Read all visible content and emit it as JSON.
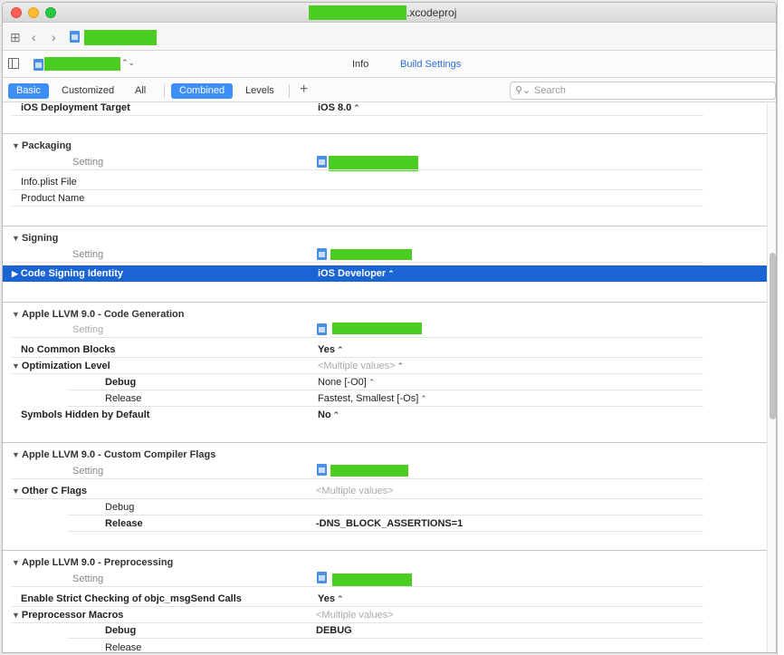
{
  "window": {
    "title_suffix": ".xcodeproj"
  },
  "editor_tabs": {
    "info": "Info",
    "build_settings": "Build Settings"
  },
  "filter": {
    "basic": "Basic",
    "customized": "Customized",
    "all": "All",
    "combined": "Combined",
    "levels": "Levels",
    "add": "+",
    "search_placeholder": "Search"
  },
  "partial_row": {
    "label": "iOS Deployment Target",
    "value": "iOS 8.0"
  },
  "sections": [
    {
      "name": "Packaging",
      "setting_header": "Setting",
      "rows": [
        {
          "label": "Info.plist File",
          "value": ""
        },
        {
          "label": "Product Name",
          "value": ""
        }
      ]
    },
    {
      "name": "Signing",
      "setting_header": "Setting",
      "rows": [
        {
          "label": "Code Signing Identity",
          "value": "iOS Developer"
        }
      ]
    },
    {
      "name": "Apple LLVM 9.0 - Code Generation",
      "setting_header": "Setting",
      "rows": [
        {
          "label": "No Common Blocks",
          "value": "Yes"
        },
        {
          "label": "Optimization Level",
          "value": "<Multiple values>"
        },
        {
          "label": "Debug",
          "value": "None [-O0]"
        },
        {
          "label": "Release",
          "value": "Fastest, Smallest [-Os]"
        },
        {
          "label": "Symbols Hidden by Default",
          "value": "No"
        }
      ]
    },
    {
      "name": "Apple LLVM 9.0 - Custom Compiler Flags",
      "setting_header": "Setting",
      "rows": [
        {
          "label": "Other C Flags",
          "value": "<Multiple values>"
        },
        {
          "label": "Debug",
          "value": ""
        },
        {
          "label": "Release",
          "value": "-DNS_BLOCK_ASSERTIONS=1"
        }
      ]
    },
    {
      "name": "Apple LLVM 9.0 - Preprocessing",
      "setting_header": "Setting",
      "rows": [
        {
          "label": "Enable Strict Checking of objc_msgSend Calls",
          "value": "Yes"
        },
        {
          "label": "Preprocessor Macros",
          "value": "<Multiple values>"
        },
        {
          "label": "Debug",
          "value": "DEBUG"
        },
        {
          "label": "Release",
          "value": ""
        }
      ]
    }
  ],
  "colors": {
    "accent": "#3d8ef7",
    "selection": "#1a64d4",
    "redaction": "#4bcd21"
  }
}
